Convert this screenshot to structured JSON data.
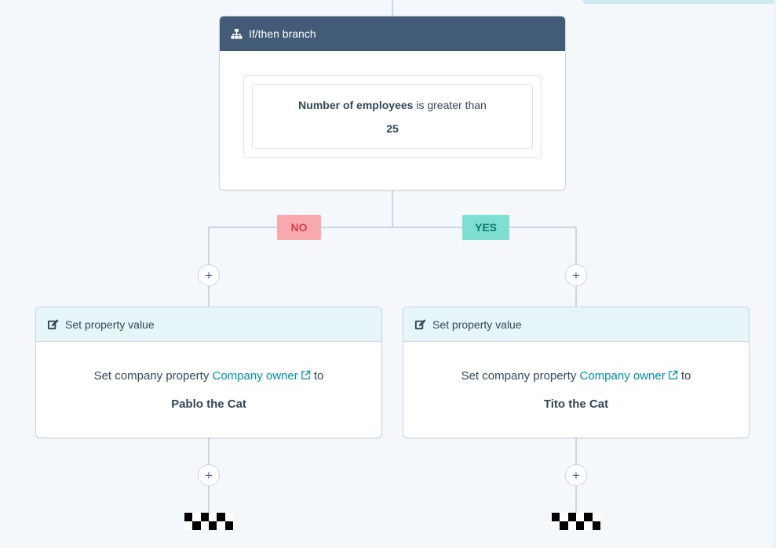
{
  "branch": {
    "title": "If/then branch",
    "icon": "branch-icon",
    "condition": {
      "property": "Number of employees",
      "operator": "is greater than",
      "value": "25"
    }
  },
  "branches": {
    "no_label": "NO",
    "yes_label": "YES"
  },
  "actions": [
    {
      "title": "Set property value",
      "icon": "edit-icon",
      "prefix": "Set company property",
      "property_link": "Company owner",
      "to_text": "to",
      "value": "Pablo the Cat"
    },
    {
      "title": "Set property value",
      "icon": "edit-icon",
      "prefix": "Set company property",
      "property_link": "Company owner",
      "to_text": "to",
      "value": "Tito the Cat"
    }
  ],
  "add_action_symbol": "+",
  "colors": {
    "canvas": "#f5f8fa",
    "branch_header": "#425b76",
    "action_header": "#e5f5f8",
    "link": "#0091ae",
    "no_badge": "#f8a9ad",
    "yes_badge": "#7fded2",
    "connector": "#cbd6e2"
  }
}
